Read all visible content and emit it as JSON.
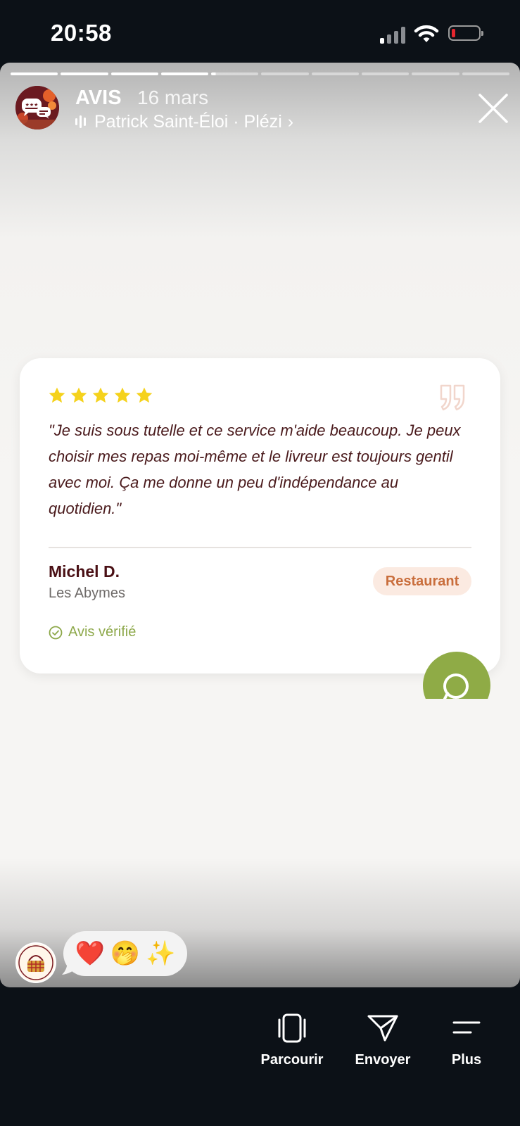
{
  "status_bar": {
    "time": "20:58",
    "icons": [
      "cellular-signal-icon",
      "wifi-icon",
      "battery-icon"
    ],
    "battery_level": 0.1,
    "battery_color": "#e5262e"
  },
  "story": {
    "segments_total": 10,
    "segments_done": 4,
    "active_segment_progress": 0.1,
    "account_name": "AVIS",
    "date": "16 mars",
    "music_label": "Patrick Saint-Éloi · Plézi",
    "music_chevron": "›"
  },
  "review_card": {
    "rating": 5,
    "max_rating": 5,
    "star_color": "#f5d21c",
    "quote_text": "\"Je suis sous tutelle et ce service m'aide beaucoup. Je peux choisir mes repas moi-même et le livreur est toujours gentil avec moi. Ça me donne un peu d'indépendance au quotidien.\"",
    "author_name": "Michel D.",
    "author_location": "Les Abymes",
    "category_badge": "Restaurant",
    "verified_label": "Avis vérifié",
    "accent_green": "#8da84a"
  },
  "reactions": {
    "emoji_heart": "❤️",
    "emoji_face": "🤭",
    "emoji_sparkles": "✨"
  },
  "bottom_nav": {
    "browse_label": "Parcourir",
    "send_label": "Envoyer",
    "more_label": "Plus"
  }
}
